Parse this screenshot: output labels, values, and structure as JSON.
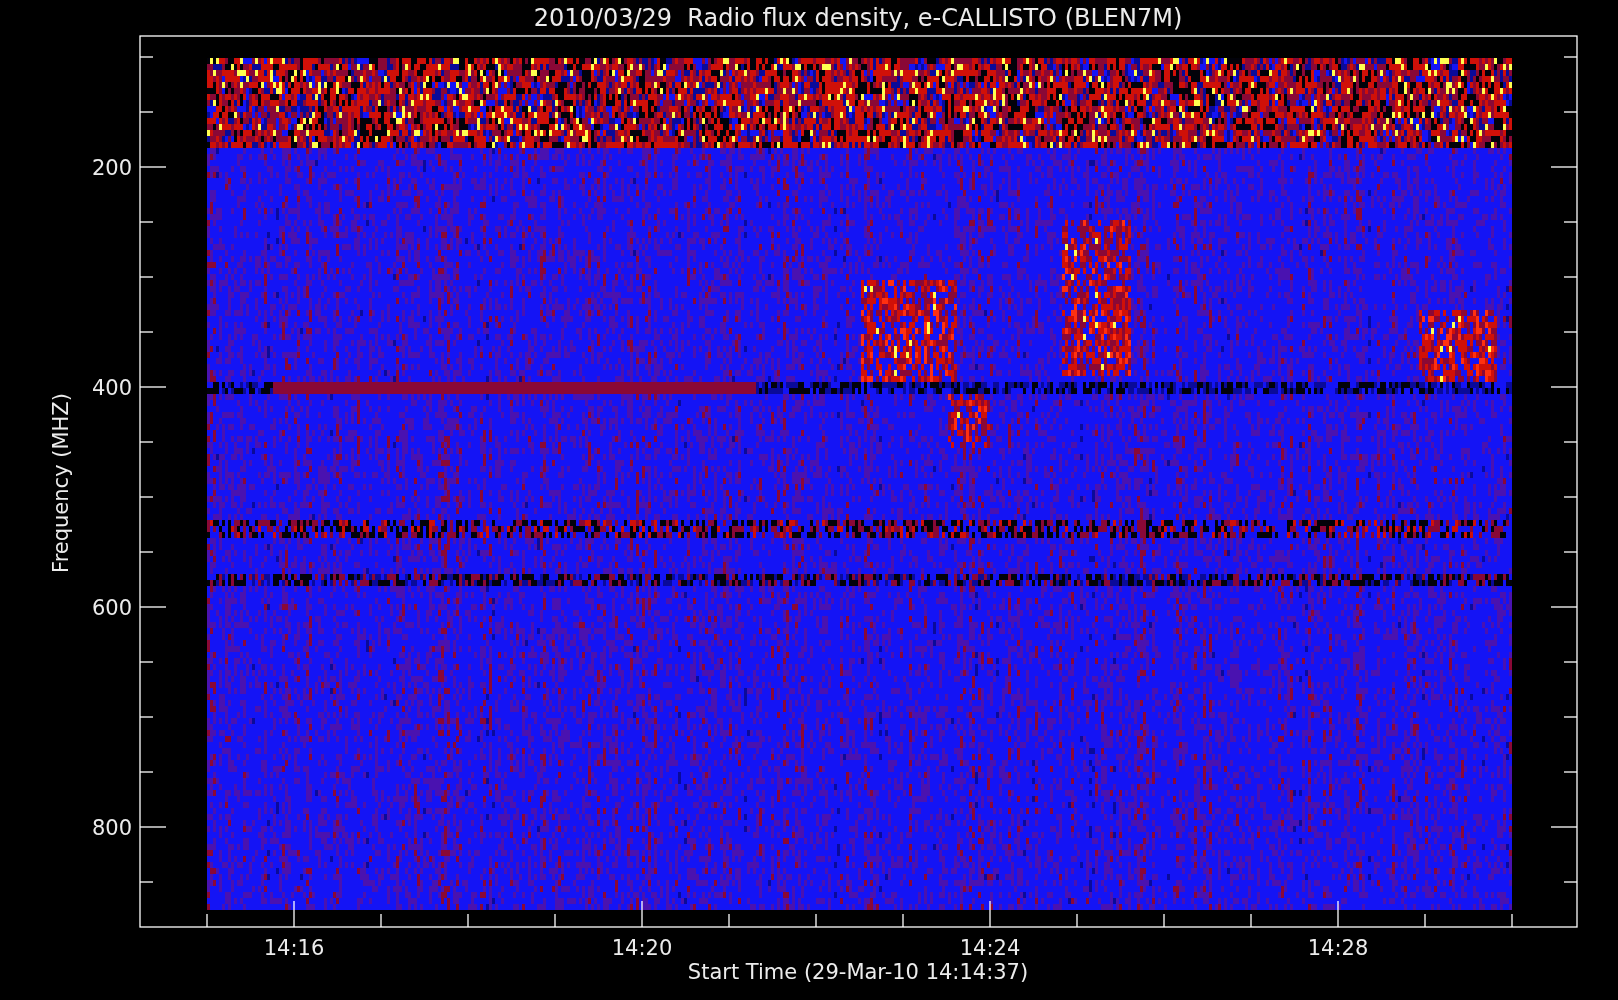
{
  "title": "2010/03/29  Radio flux density, e-CALLISTO (BLEN7M)",
  "y_axis": {
    "title": "Frequency (MHZ)",
    "ticks": [
      "200",
      "400",
      "600",
      "800"
    ]
  },
  "x_axis": {
    "title": "Start Time (29-Mar-10 14:14:37)",
    "ticks": [
      "14:16",
      "14:20",
      "14:24",
      "14:28"
    ]
  }
}
